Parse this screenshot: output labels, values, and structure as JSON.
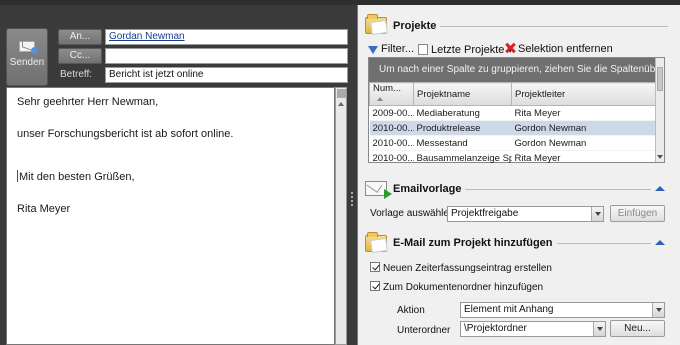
{
  "compose": {
    "send_label": "Senden",
    "to_label": "An...",
    "cc_label": "Cc...",
    "subject_label": "Betreff:",
    "to_value": "Gordan Newman",
    "cc_value": "",
    "subject_value": "Bericht ist jetzt online",
    "body": {
      "greeting": "Sehr geehrter Herr Newman,",
      "line1": "unser Forschungsbericht ist ab sofort online.",
      "closing": "Mit den besten Grüßen,",
      "signature": "Rita Meyer"
    }
  },
  "projects": {
    "title": "Projekte",
    "toolbar": {
      "filter": "Filter...",
      "recent": "Letzte Projekte",
      "clear": "Selektion entfernen"
    },
    "group_hint": "Um nach einer Spalte zu gruppieren, ziehen Sie die Spaltenüberschrift hier",
    "columns": [
      "Num...",
      "Projektname",
      "Projektleiter"
    ],
    "rows": [
      {
        "num": "2009-00...",
        "name": "Mediaberatung",
        "lead": "Rita Meyer"
      },
      {
        "num": "2010-00...",
        "name": "Produktrelease",
        "lead": "Gordon Newman"
      },
      {
        "num": "2010-00...",
        "name": "Messestand",
        "lead": "Gordon Newman"
      },
      {
        "num": "2010-00...",
        "name": "Bausammelanzeige Spe...",
        "lead": "Rita Meyer"
      }
    ]
  },
  "template": {
    "title": "Emailvorlage",
    "choose_label": "Vorlage auswählen",
    "selected": "Projektfreigabe",
    "insert_button": "Einfügen"
  },
  "attach": {
    "title": "E-Mail zum Projekt hinzufügen",
    "option1": "Neuen Zeiterfassungseintrag erstellen",
    "option2": "Zum Dokumentenordner hinzufügen",
    "action_label": "Aktion",
    "action_value": "Element mit Anhang",
    "subfolder_label": "Unterordner",
    "subfolder_value": "\\Projektordner",
    "new_button": "Neu..."
  },
  "colors": {
    "selection": "#cdd9e8",
    "accent": "#2d63b8"
  }
}
